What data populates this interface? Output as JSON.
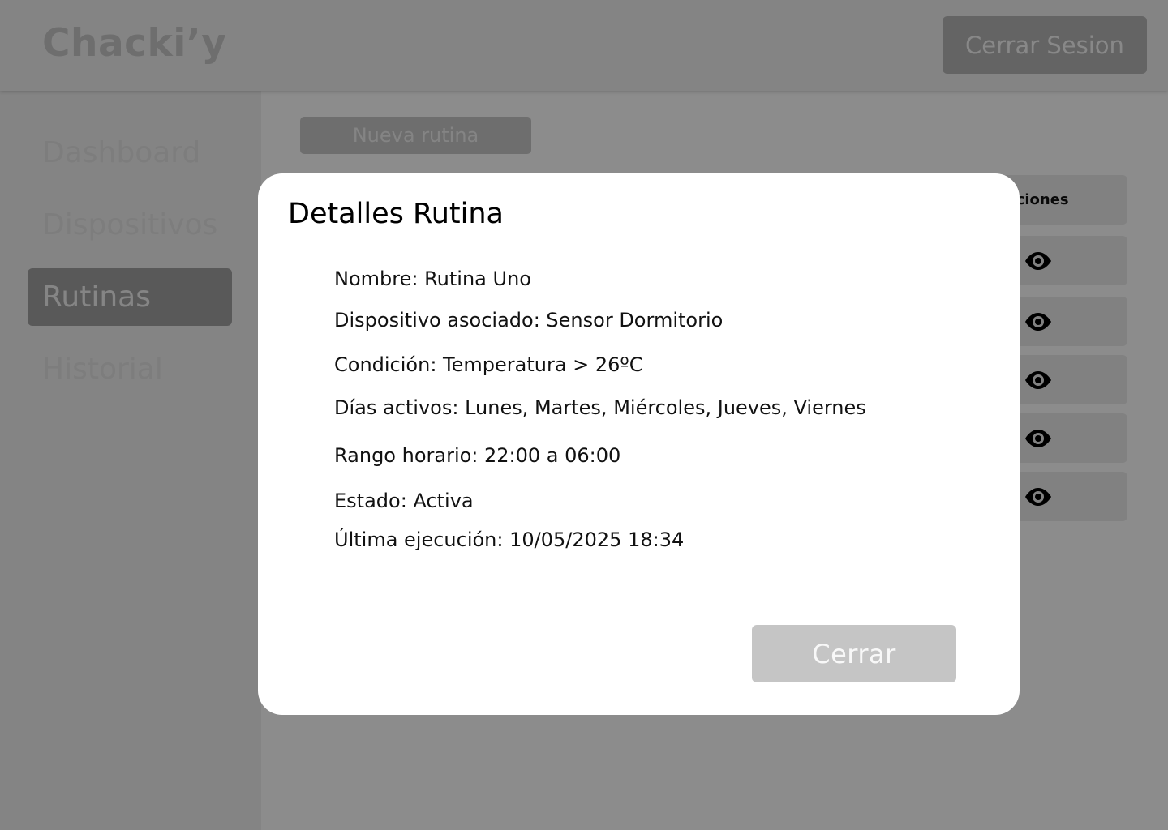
{
  "app": {
    "brand": "Chacki’y",
    "logout_label": "Cerrar Sesion"
  },
  "sidebar": {
    "items": [
      {
        "label": "Dashboard",
        "active": false
      },
      {
        "label": "Dispositivos",
        "active": false
      },
      {
        "label": "Rutinas",
        "active": true
      },
      {
        "label": "Historial",
        "active": false
      }
    ]
  },
  "main": {
    "new_routine_label": "Nueva rutina",
    "table": {
      "visible_header": "cciones",
      "row_action_icon": "eye-icon",
      "row_count": 5
    }
  },
  "modal": {
    "title": "Detalles Rutina",
    "details": [
      "Nombre: Rutina Uno",
      "Dispositivo asociado: Sensor Dormitorio",
      "Condición: Temperatura > 26ºC",
      "Días activos: Lunes, Martes, Miércoles, Jueves, Viernes",
      "Rango horario: 22:00 a 06:00",
      "Estado: Activa",
      "Última ejecución: 10/05/2025 18:34"
    ],
    "close_label": "Cerrar"
  },
  "colors": {
    "overlay": "#000000",
    "active_nav": "#a3a3a3",
    "modal_bg": "#ffffff"
  }
}
